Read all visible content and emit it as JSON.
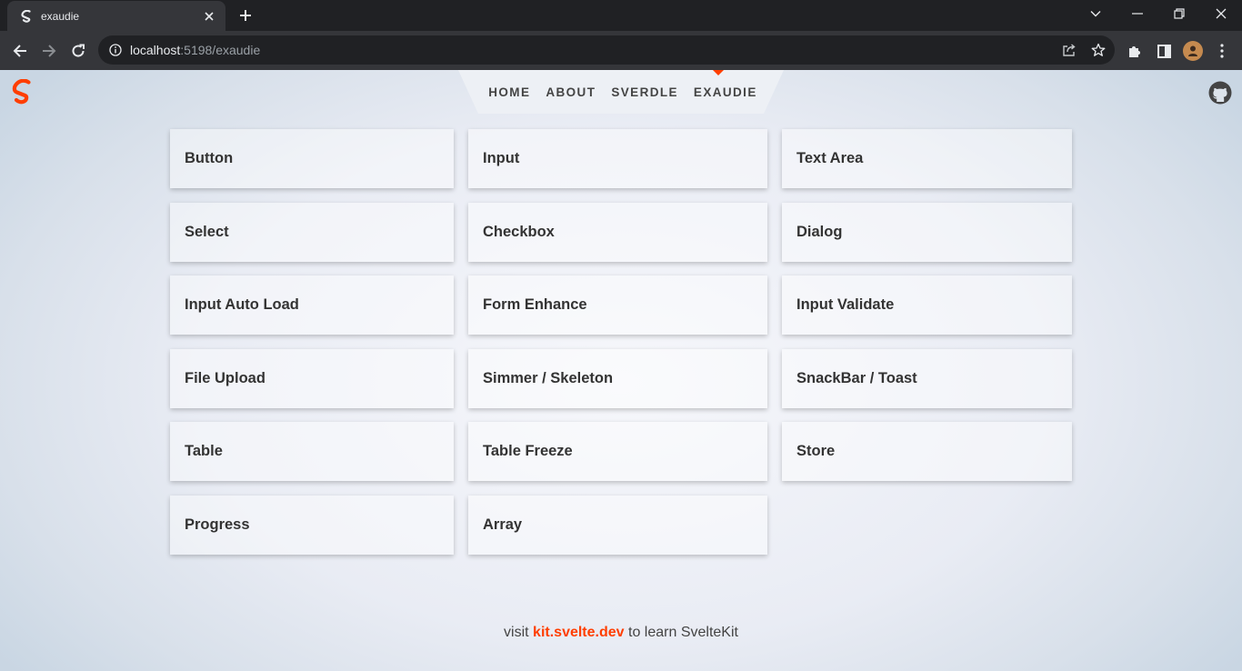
{
  "browser": {
    "tab_title": "exaudie",
    "url_host": "localhost",
    "url_rest": ":5198/exaudie"
  },
  "nav": {
    "items": [
      "HOME",
      "ABOUT",
      "SVERDLE",
      "EXAUDIE"
    ],
    "active": "EXAUDIE",
    "accent": "#ff3e00"
  },
  "cards": [
    [
      "Button",
      "Input",
      "Text Area"
    ],
    [
      "Select",
      "Checkbox",
      "Dialog"
    ],
    [
      "Input Auto Load",
      "Form Enhance",
      "Input Validate"
    ],
    [
      "File Upload",
      "Simmer / Skeleton",
      "SnackBar / Toast"
    ],
    [
      "Table",
      "Table Freeze",
      "Store"
    ],
    [
      "Progress",
      "Array"
    ]
  ],
  "footer": {
    "prefix": "visit",
    "link": "kit.svelte.dev",
    "suffix": "to learn SvelteKit"
  }
}
